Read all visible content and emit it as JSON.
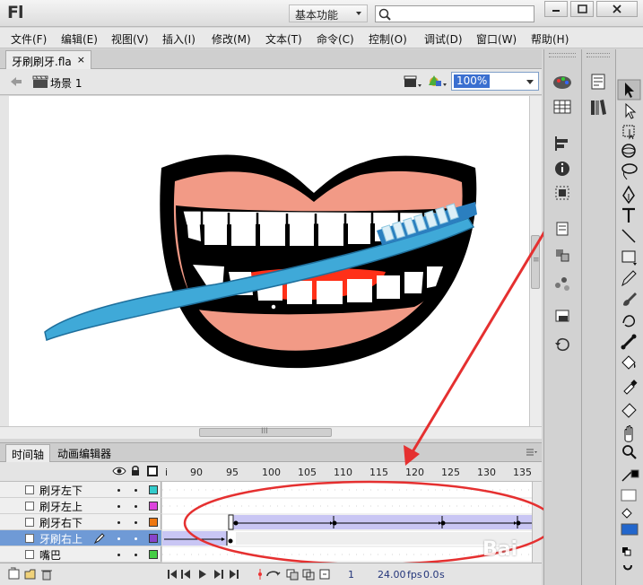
{
  "app": {
    "logo": "Fl",
    "workspace": "基本功能"
  },
  "menu": [
    "文件(F)",
    "编辑(E)",
    "视图(V)",
    "插入(I)",
    "修改(M)",
    "文本(T)",
    "命令(C)",
    "控制(O)",
    "调试(D)",
    "窗口(W)",
    "帮助(H)"
  ],
  "document": {
    "tab": "牙刷刷牙.fla",
    "close": "×",
    "scene": "场景 1",
    "zoom": "100%"
  },
  "scroll": {
    "h_grip": "III",
    "v_grip": "≡"
  },
  "timeline": {
    "tabs": [
      "时间轴",
      "动画编辑器"
    ],
    "frame_numbers": [
      "i",
      "90",
      "95",
      "100",
      "105",
      "110",
      "115",
      "120",
      "125",
      "130",
      "135"
    ],
    "layers": [
      {
        "name": "刷牙左下",
        "color": "#33cccc"
      },
      {
        "name": "刷牙左上",
        "color": "#dd44dd"
      },
      {
        "name": "刷牙右下",
        "color": "#ee7711"
      },
      {
        "name": "牙刷右上",
        "color": "#8844cc",
        "selected": true
      },
      {
        "name": "嘴巴",
        "color": "#44cc44"
      }
    ],
    "footer": {
      "frame": "1",
      "fps": "24.00",
      "fps_unit": "fps",
      "time": "0.0",
      "time_unit": "s"
    }
  },
  "watermark": "Bai",
  "icons": {
    "title": [
      "search-icon",
      "minimize-icon",
      "maximize-icon",
      "close-icon"
    ],
    "edit": [
      "back-arrow-icon",
      "scene-clapper-icon",
      "edit-symbols-icon",
      "edit-scene-icon"
    ],
    "timeline": [
      "eye-icon",
      "lock-icon",
      "outline-icon",
      "pencil-icon"
    ],
    "tools": [
      "selection-tool-icon",
      "subselection-tool-icon",
      "free-transform-tool-icon",
      "3d-rotation-tool-icon",
      "lasso-tool-icon",
      "pen-tool-icon",
      "text-tool-icon",
      "line-tool-icon",
      "rectangle-tool-icon",
      "pencil-tool-icon",
      "brush-tool-icon",
      "deco-tool-icon",
      "bone-tool-icon",
      "paint-bucket-tool-icon",
      "eyedropper-tool-icon",
      "eraser-tool-icon",
      "hand-tool-icon",
      "zoom-tool-icon"
    ]
  }
}
